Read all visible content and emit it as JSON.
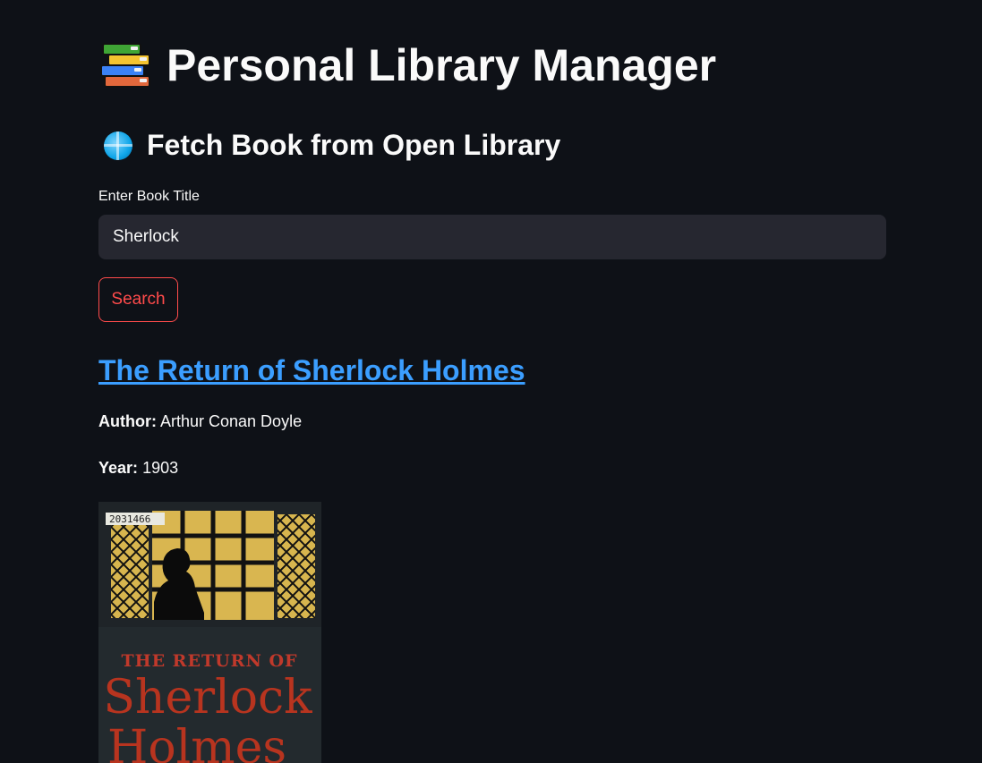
{
  "app": {
    "title": "Personal Library Manager",
    "title_icon": "books-icon"
  },
  "fetch": {
    "heading": "Fetch Book from Open Library",
    "heading_icon": "globe-icon",
    "input_label": "Enter Book Title",
    "input_value": "Sherlock",
    "search_button": "Search"
  },
  "result": {
    "title": "The Return of Sherlock Holmes",
    "author_label": "Author:",
    "author": "Arthur Conan Doyle",
    "year_label": "Year:",
    "year": "1903",
    "cover": {
      "stamp": "2031466",
      "line1": "THE RETURN OF",
      "line2": "Sherlock",
      "line3": "Holmes"
    }
  },
  "colors": {
    "background": "#0e1117",
    "input_bg": "#262730",
    "accent": "#ff4b4b",
    "link": "#3b9eff"
  }
}
